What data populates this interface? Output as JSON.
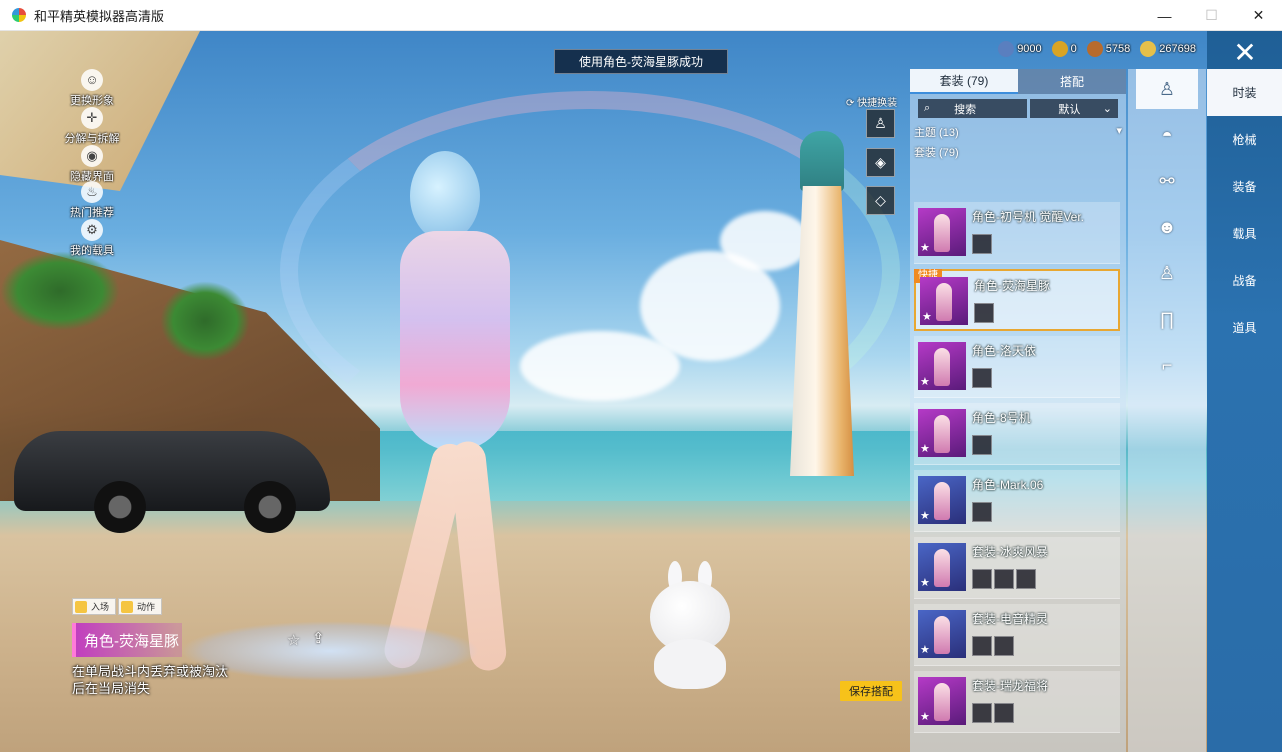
{
  "window": {
    "title": "和平精英模拟器高清版",
    "minimize": "—",
    "maximize": "☐",
    "close": "✕"
  },
  "toast": "使用角色-荧海星豚成功",
  "currency": [
    {
      "icon": "crystal-coin-icon",
      "value": "9000",
      "color": "#5a7fbf"
    },
    {
      "icon": "gold-token-icon",
      "value": "0",
      "color": "#d9a425"
    },
    {
      "icon": "bronze-coin-icon",
      "value": "5758",
      "color": "#b86b2d"
    },
    {
      "icon": "gold-coin-icon",
      "value": "267698",
      "color": "#e6c04a"
    }
  ],
  "side_buttons": [
    {
      "name": "change-look-button",
      "icon": "person-icon",
      "label": "更换形象"
    },
    {
      "name": "split-button",
      "icon": "split-icon",
      "label": "分解与拆解"
    },
    {
      "name": "view-button",
      "icon": "eye-icon",
      "label": "隐藏界面"
    },
    {
      "name": "hot-button",
      "icon": "fire-icon",
      "label": "热门推荐"
    },
    {
      "name": "vehicle-button",
      "icon": "car-icon",
      "label": "我的载具"
    }
  ],
  "quick_switch": {
    "label": "快捷换装"
  },
  "character_info": {
    "tab_entrance": "入场",
    "tab_action": "动作",
    "name": "角色-荧海星豚",
    "description": "在单局战斗内丢弃或被淘汰后在当局消失"
  },
  "save_button": "保存搭配",
  "panel": {
    "tabs": [
      "套装 (79)",
      "搭配"
    ],
    "search": "搜索",
    "sort": "默认",
    "filter_theme": "主题 (13)",
    "filter_sets": "套装 (79)",
    "quick_badge": "快捷",
    "outfits": [
      {
        "name": "角色-初号机 觉醒Ver."
      },
      {
        "name": "角色-荧海星豚"
      },
      {
        "name": "角色-洛天依"
      },
      {
        "name": "角色-8号机"
      },
      {
        "name": "角色-Mark.06"
      },
      {
        "name": "套装-冰爽风暴"
      },
      {
        "name": "套装-电音精灵"
      },
      {
        "name": "套装-瑞龙福将"
      }
    ]
  },
  "categories": [
    "时装",
    "枪械",
    "装备",
    "载具",
    "战备",
    "道具"
  ],
  "accent_color": "#f7c21a",
  "selection_color": "#e8a732"
}
